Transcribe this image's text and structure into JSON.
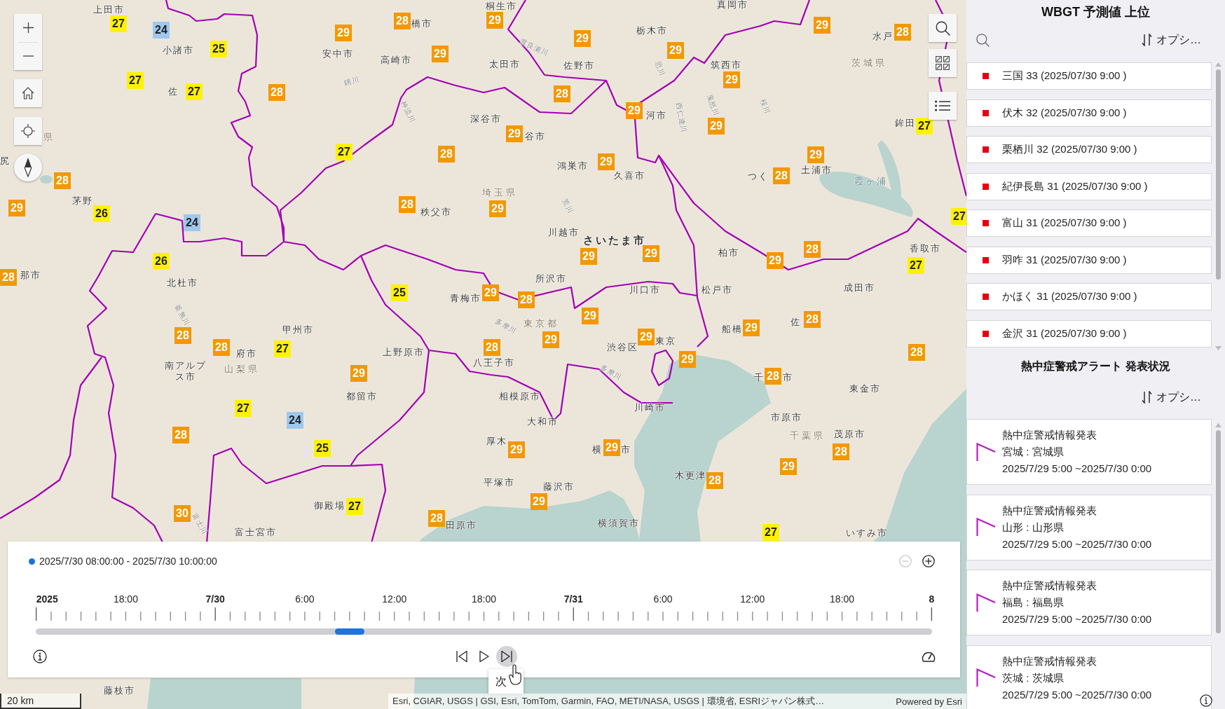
{
  "map": {
    "places": [
      {
        "name": "上田市",
        "kind": "city"
      },
      {
        "name": "小諸市",
        "kind": "city"
      },
      {
        "name": "佐",
        "kind": "city"
      },
      {
        "name": "県",
        "kind": "prefecture"
      },
      {
        "name": "尻",
        "kind": "city"
      },
      {
        "name": "茅野",
        "kind": "city"
      },
      {
        "name": "那市",
        "kind": "city"
      },
      {
        "name": "北杜市",
        "kind": "city"
      },
      {
        "name": "甲州市",
        "kind": "city"
      },
      {
        "name": "府市",
        "kind": "city"
      },
      {
        "name": "南アルプス市",
        "kind": "city"
      },
      {
        "name": "山梨県",
        "kind": "prefecture"
      },
      {
        "name": "上野原市",
        "kind": "city"
      },
      {
        "name": "都留市",
        "kind": "city"
      },
      {
        "name": "御殿場",
        "kind": "city"
      },
      {
        "name": "富士宮市",
        "kind": "city"
      },
      {
        "name": "田原市",
        "kind": "city"
      },
      {
        "name": "青梅市",
        "kind": "city"
      },
      {
        "name": "秩父市",
        "kind": "city"
      },
      {
        "name": "安中市",
        "kind": "city"
      },
      {
        "name": "高崎市",
        "kind": "city"
      },
      {
        "name": "橋市",
        "kind": "city"
      },
      {
        "name": "深谷市",
        "kind": "city"
      },
      {
        "name": "鏑川",
        "kind": "river"
      },
      {
        "name": "神流川",
        "kind": "river"
      },
      {
        "name": "釜無川",
        "kind": "river"
      },
      {
        "name": "富士川",
        "kind": "river"
      },
      {
        "name": "桐生市",
        "kind": "city"
      },
      {
        "name": "真岡市",
        "kind": "city"
      },
      {
        "name": "栃木市",
        "kind": "city"
      },
      {
        "name": "太田市",
        "kind": "city"
      },
      {
        "name": "佐野市",
        "kind": "city"
      },
      {
        "name": "渡良瀬川",
        "kind": "river"
      },
      {
        "name": "思川",
        "kind": "river"
      },
      {
        "name": "筑西市",
        "kind": "city"
      },
      {
        "name": "水戸",
        "kind": "city"
      },
      {
        "name": "茨城県",
        "kind": "prefecture"
      },
      {
        "name": "河市",
        "kind": "city"
      },
      {
        "name": "谷市",
        "kind": "city"
      },
      {
        "name": "西仁連川",
        "kind": "river"
      },
      {
        "name": "鬼怒川",
        "kind": "river"
      },
      {
        "name": "桜川",
        "kind": "river"
      },
      {
        "name": "鉾田",
        "kind": "city"
      },
      {
        "name": "鴻巣市",
        "kind": "city"
      },
      {
        "name": "久喜市",
        "kind": "city"
      },
      {
        "name": "土浦市",
        "kind": "city"
      },
      {
        "name": "つく",
        "kind": "city"
      },
      {
        "name": "霞ヶ浦",
        "kind": "water"
      },
      {
        "name": "埼玉県",
        "kind": "prefecture"
      },
      {
        "name": "荒川",
        "kind": "river"
      },
      {
        "name": "川越市",
        "kind": "city"
      },
      {
        "name": "さいたま市",
        "kind": "major"
      },
      {
        "name": "柏市",
        "kind": "city"
      },
      {
        "name": "香取市",
        "kind": "city"
      },
      {
        "name": "成田市",
        "kind": "city"
      },
      {
        "name": "所沢市",
        "kind": "city"
      },
      {
        "name": "川口市",
        "kind": "city"
      },
      {
        "name": "松戸市",
        "kind": "city"
      },
      {
        "name": "多摩川",
        "kind": "river"
      },
      {
        "name": "東京都",
        "kind": "prefecture"
      },
      {
        "name": "船橋",
        "kind": "city"
      },
      {
        "name": "佐",
        "kind": "city"
      },
      {
        "name": "渋谷区",
        "kind": "city"
      },
      {
        "name": "東京",
        "kind": "city"
      },
      {
        "name": "八王子市",
        "kind": "city"
      },
      {
        "name": "相模原市",
        "kind": "city"
      },
      {
        "name": "多摩川",
        "kind": "river"
      },
      {
        "name": "大和市",
        "kind": "city"
      },
      {
        "name": "厚木",
        "kind": "city"
      },
      {
        "name": "川崎市",
        "kind": "city"
      },
      {
        "name": "横",
        "kind": "city"
      },
      {
        "name": "市",
        "kind": "city"
      },
      {
        "name": "千",
        "kind": "city"
      },
      {
        "name": "市",
        "kind": "city"
      },
      {
        "name": "東金市",
        "kind": "city"
      },
      {
        "name": "市原市",
        "kind": "city"
      },
      {
        "name": "千葉県",
        "kind": "prefecture"
      },
      {
        "name": "茂原市",
        "kind": "city"
      },
      {
        "name": "平塚市",
        "kind": "city"
      },
      {
        "name": "藤沢市",
        "kind": "city"
      },
      {
        "name": "木更津",
        "kind": "city"
      },
      {
        "name": "横須賀市",
        "kind": "city"
      },
      {
        "name": "いすみ市",
        "kind": "city"
      },
      {
        "name": "藤枝市",
        "kind": "city"
      }
    ],
    "markers": [
      {
        "value": "27",
        "color": "#fff200"
      },
      {
        "value": "24",
        "color": "#9ec8ef"
      },
      {
        "value": "25",
        "color": "#fff200"
      },
      {
        "value": "27",
        "color": "#fff200"
      },
      {
        "value": "27",
        "color": "#fff200"
      },
      {
        "value": "28",
        "color": "#f39800"
      },
      {
        "value": "29",
        "color": "#f39800"
      },
      {
        "value": "28",
        "color": "#f39800"
      },
      {
        "value": "29",
        "color": "#f39800"
      },
      {
        "value": "27",
        "color": "#fff200"
      },
      {
        "value": "28",
        "color": "#f39800"
      },
      {
        "value": "28",
        "color": "#f39800"
      },
      {
        "value": "29",
        "color": "#f39800"
      },
      {
        "value": "26",
        "color": "#fff200"
      },
      {
        "value": "24",
        "color": "#9ec8ef"
      },
      {
        "value": "28",
        "color": "#f39800"
      },
      {
        "value": "26",
        "color": "#fff200"
      },
      {
        "value": "28",
        "color": "#f39800"
      },
      {
        "value": "25",
        "color": "#fff200"
      },
      {
        "value": "28",
        "color": "#f39800"
      },
      {
        "value": "28",
        "color": "#f39800"
      },
      {
        "value": "27",
        "color": "#fff200"
      },
      {
        "value": "29",
        "color": "#f39800"
      },
      {
        "value": "27",
        "color": "#fff200"
      },
      {
        "value": "24",
        "color": "#9ec8ef"
      },
      {
        "value": "28",
        "color": "#f39800"
      },
      {
        "value": "25",
        "color": "#fff200"
      },
      {
        "value": "30",
        "color": "#f39800"
      },
      {
        "value": "27",
        "color": "#fff200"
      },
      {
        "value": "28",
        "color": "#f39800"
      },
      {
        "value": "29",
        "color": "#f39800"
      },
      {
        "value": "29",
        "color": "#f39800"
      },
      {
        "value": "29",
        "color": "#f39800"
      },
      {
        "value": "29",
        "color": "#f39800"
      },
      {
        "value": "28",
        "color": "#f39800"
      },
      {
        "value": "28",
        "color": "#f39800"
      },
      {
        "value": "29",
        "color": "#f39800"
      },
      {
        "value": "29",
        "color": "#f39800"
      },
      {
        "value": "29",
        "color": "#f39800"
      },
      {
        "value": "29",
        "color": "#f39800"
      },
      {
        "value": "27",
        "color": "#fff200"
      },
      {
        "value": "29",
        "color": "#f39800"
      },
      {
        "value": "29",
        "color": "#f39800"
      },
      {
        "value": "28",
        "color": "#f39800"
      },
      {
        "value": "29",
        "color": "#f39800"
      },
      {
        "value": "27",
        "color": "#fff200"
      },
      {
        "value": "29",
        "color": "#f39800"
      },
      {
        "value": "29",
        "color": "#f39800"
      },
      {
        "value": "28",
        "color": "#f39800"
      },
      {
        "value": "29",
        "color": "#f39800"
      },
      {
        "value": "27",
        "color": "#fff200"
      },
      {
        "value": "29",
        "color": "#f39800"
      },
      {
        "value": "28",
        "color": "#f39800"
      },
      {
        "value": "29",
        "color": "#f39800"
      },
      {
        "value": "29",
        "color": "#f39800"
      },
      {
        "value": "29",
        "color": "#f39800"
      },
      {
        "value": "28",
        "color": "#f39800"
      },
      {
        "value": "29",
        "color": "#f39800"
      },
      {
        "value": "29",
        "color": "#f39800"
      },
      {
        "value": "28",
        "color": "#f39800"
      },
      {
        "value": "28",
        "color": "#f39800"
      },
      {
        "value": "28",
        "color": "#f39800"
      },
      {
        "value": "28",
        "color": "#f39800"
      },
      {
        "value": "29",
        "color": "#f39800"
      },
      {
        "value": "28",
        "color": "#f39800"
      },
      {
        "value": "29",
        "color": "#f39800"
      },
      {
        "value": "29",
        "color": "#f39800"
      },
      {
        "value": "29",
        "color": "#f39800"
      },
      {
        "value": "27",
        "color": "#fff200"
      }
    ],
    "scale": "20 km",
    "attribution": "Esri, CGIAR, USGS | GSI, Esri, TomTom, Garmin, FAO, METI/NASA, USGS | 環境省, ESRIジャパン株式…",
    "powered_by": "Powered by Esri"
  },
  "timeline": {
    "range": "2025/7/30 08:00:00 - 2025/7/30 10:00:00",
    "zoom_buttons": [
      {
        "kind": "zoom-out",
        "disabled": true
      },
      {
        "kind": "zoom-in",
        "disabled": false
      }
    ],
    "ticks": [
      {
        "label": "2025",
        "kind": "date"
      },
      {
        "label": "18:00",
        "kind": "time"
      },
      {
        "label": "7/30",
        "kind": "date"
      },
      {
        "label": "6:00",
        "kind": "time"
      },
      {
        "label": "12:00",
        "kind": "time"
      },
      {
        "label": "18:00",
        "kind": "time"
      },
      {
        "label": "7/31",
        "kind": "date"
      },
      {
        "label": "6:00",
        "kind": "time"
      },
      {
        "label": "12:00",
        "kind": "time"
      },
      {
        "label": "18:00",
        "kind": "time"
      },
      {
        "label": "8",
        "kind": "date"
      }
    ],
    "thumb": {
      "level": 0.35
    },
    "playback": [
      {
        "kind": "previous",
        "hovered": false
      },
      {
        "kind": "play",
        "hovered": false
      },
      {
        "kind": "next",
        "hovered": true
      }
    ],
    "tooltip": "次"
  },
  "ranking": {
    "title": "WBGT 予測値 上位",
    "options": "オプシ…",
    "items": [
      {
        "text": "三国 33 (2025/07/30 9:00 )",
        "color": "#e60012"
      },
      {
        "text": "伏木 32 (2025/07/30 9:00 )",
        "color": "#e60012"
      },
      {
        "text": "栗栖川 32 (2025/07/30 9:00 )",
        "color": "#e60012"
      },
      {
        "text": "紀伊長島 31 (2025/07/30 9:00 )",
        "color": "#e60012"
      },
      {
        "text": "富山 31 (2025/07/30 9:00 )",
        "color": "#e60012"
      },
      {
        "text": "羽咋 31 (2025/07/30 9:00 )",
        "color": "#e60012"
      },
      {
        "text": "かほく 31 (2025/07/30 9:00 )",
        "color": "#e60012"
      },
      {
        "text": "金沢 31 (2025/07/30 9:00 )",
        "color": "#e60012"
      }
    ]
  },
  "alerts": {
    "title": "熱中症警戒アラート 発表状況",
    "options": "オプシ…",
    "items": [
      {
        "heading": "熱中症警戒情報発表",
        "area": "宮城 : 宮城県",
        "period": "2025/7/29 5:00 ~2025/7/30 0:00"
      },
      {
        "heading": "熱中症警戒情報発表",
        "area": "山形 : 山形県",
        "period": "2025/7/29 5:00 ~2025/7/30 0:00"
      },
      {
        "heading": "熱中症警戒情報発表",
        "area": "福島 : 福島県",
        "period": "2025/7/29 5:00 ~2025/7/30 0:00"
      },
      {
        "heading": "熱中症警戒情報発表",
        "area": "茨城 : 茨城県",
        "period": "2025/7/29 5:00 ~2025/7/30 0:00"
      }
    ]
  }
}
